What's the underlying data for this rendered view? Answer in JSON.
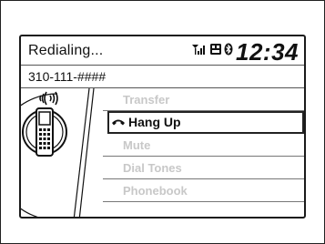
{
  "header": {
    "title": "Redialing...",
    "clock": "12:34",
    "status_icons": [
      "signal-battery-icon",
      "roaming-icon",
      "bluetooth-icon"
    ]
  },
  "call": {
    "number": "310-111-####"
  },
  "menu": {
    "items": [
      {
        "label": "Transfer",
        "state": "disabled"
      },
      {
        "label": "Hang Up",
        "state": "selected",
        "icon": "handset-icon"
      },
      {
        "label": "Mute",
        "state": "disabled"
      },
      {
        "label": "Dial Tones",
        "state": "disabled"
      },
      {
        "label": "Phonebook",
        "state": "disabled"
      }
    ]
  }
}
